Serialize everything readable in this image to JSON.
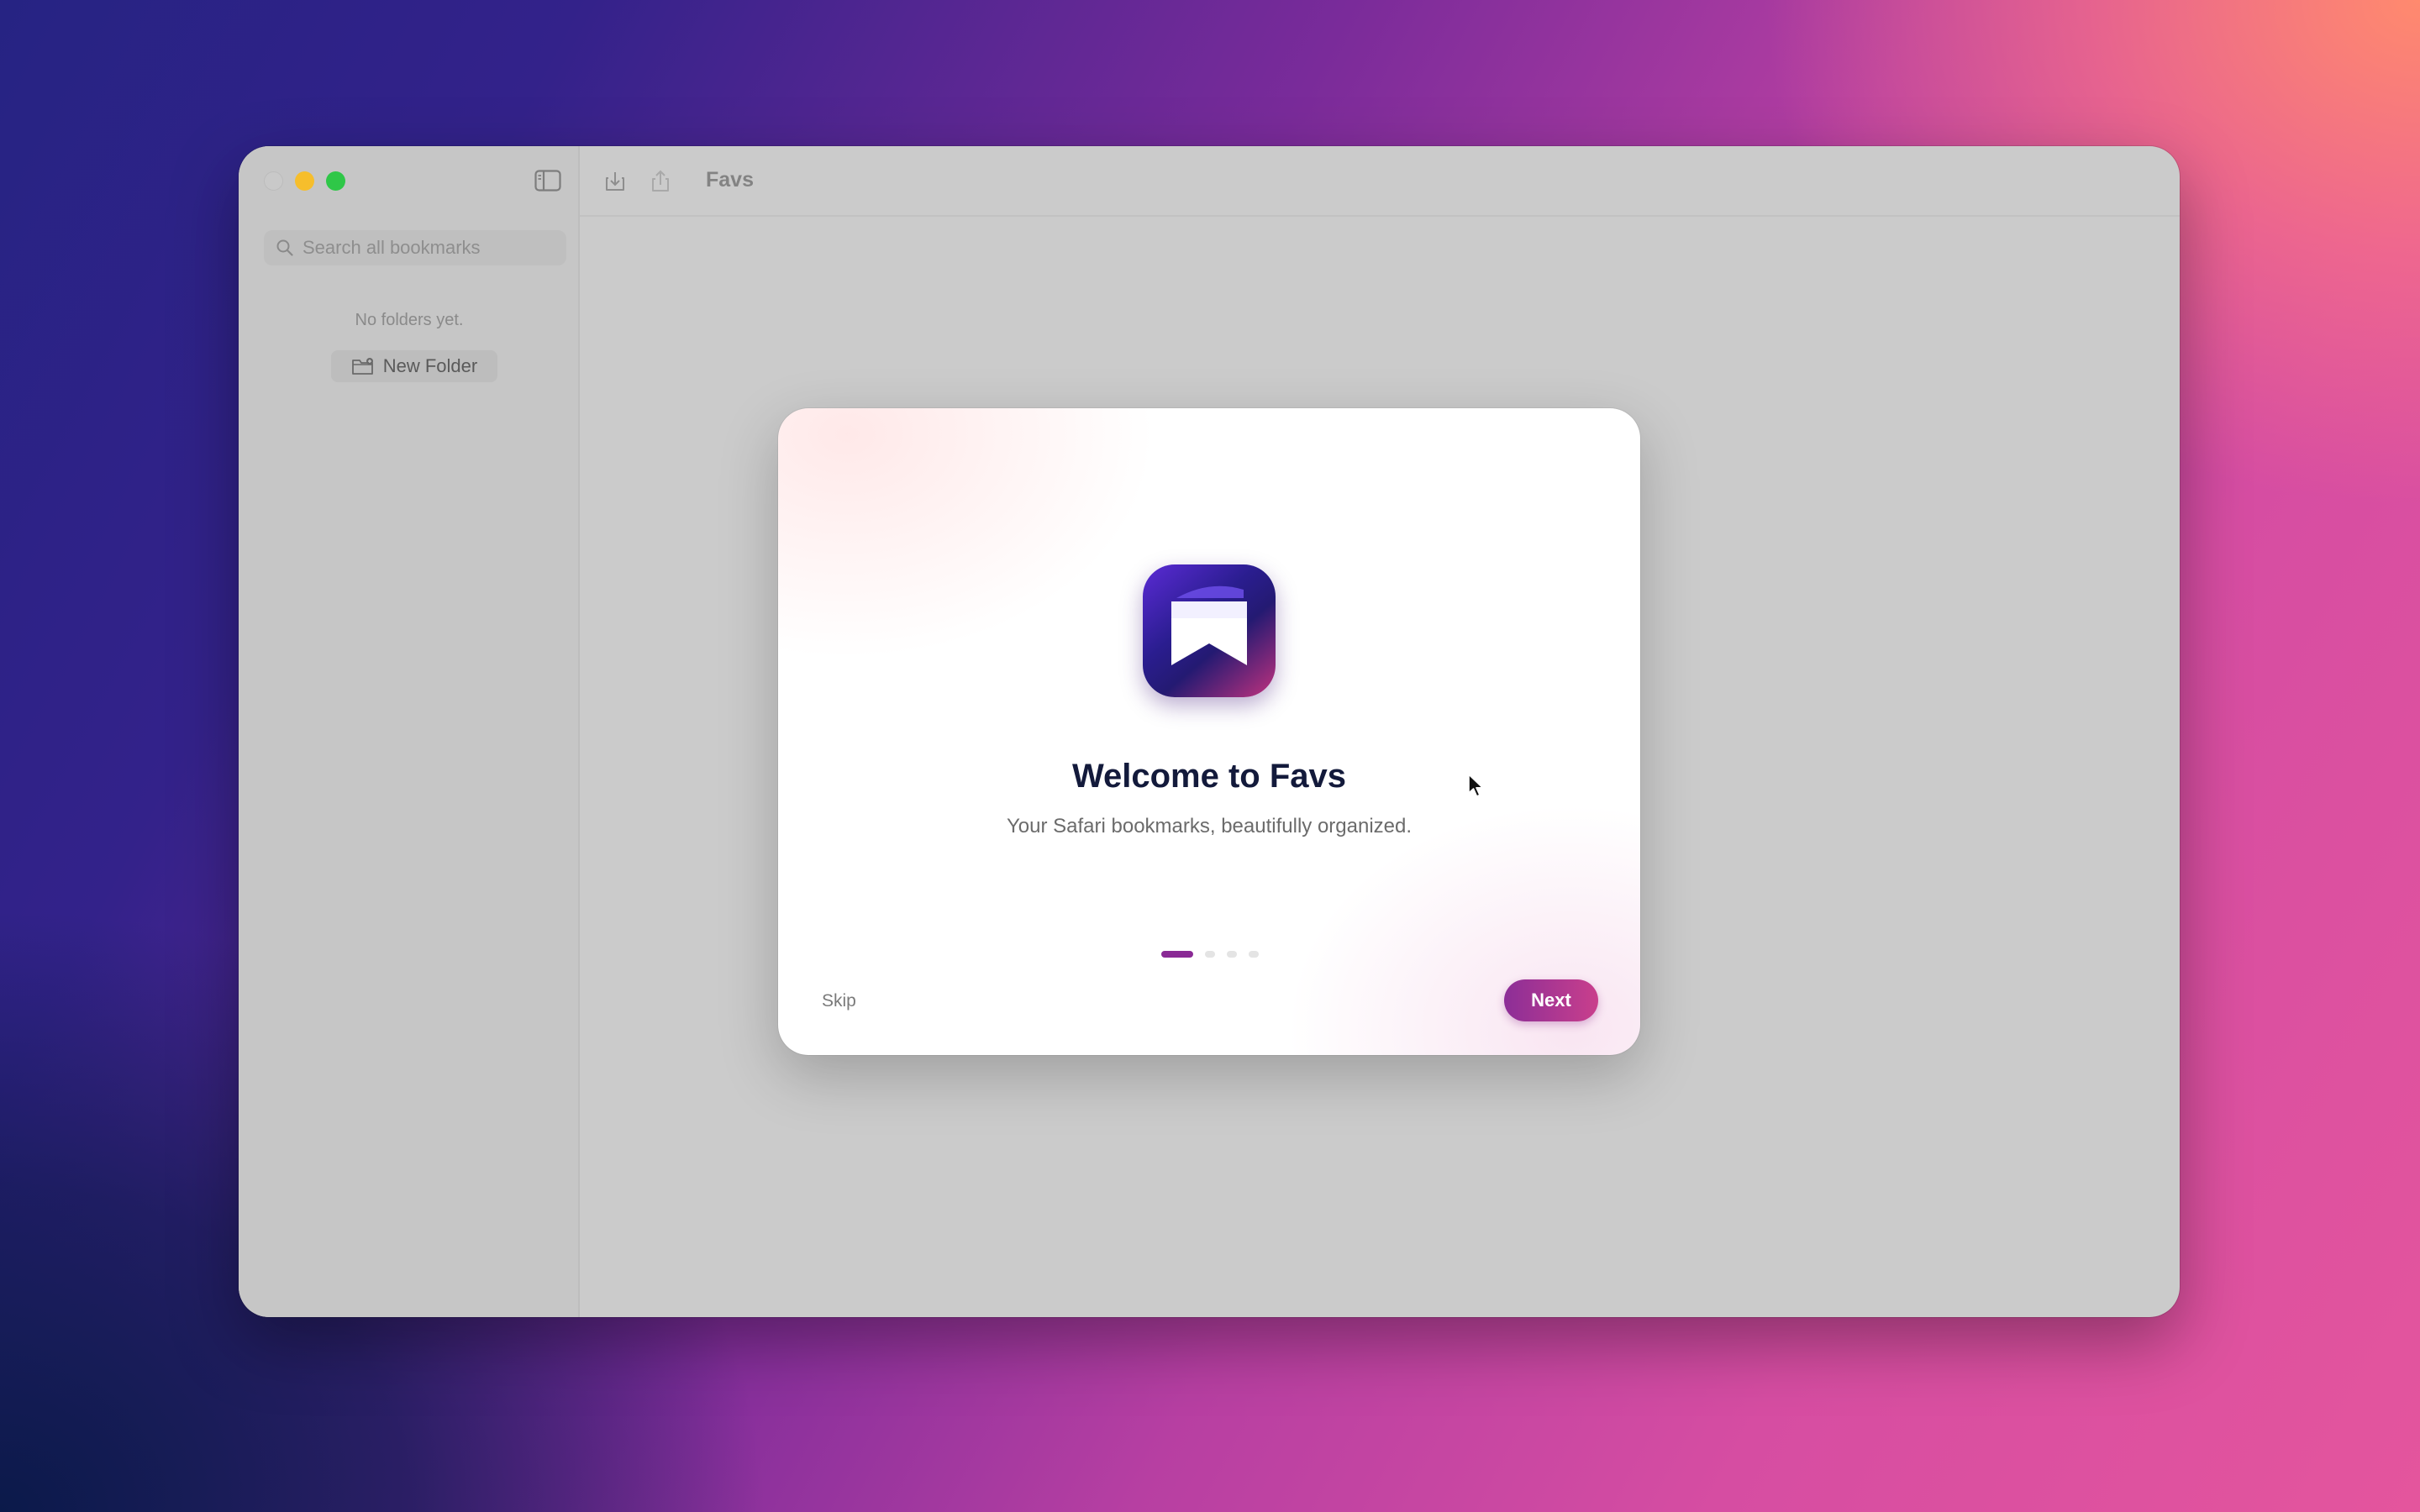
{
  "window": {
    "title": "Favs"
  },
  "sidebar": {
    "search": {
      "placeholder": "Search all bookmarks",
      "value": ""
    },
    "empty_message": "No folders yet.",
    "new_folder_label": "New Folder"
  },
  "welcome": {
    "title": "Welcome to Favs",
    "subtitle": "Your Safari bookmarks, beautifully organized.",
    "page_indicator": {
      "current": 1,
      "total": 4
    },
    "skip_label": "Skip",
    "next_label": "Next"
  },
  "colors": {
    "accent_start": "#8c2e97",
    "accent_end": "#c93f8c",
    "title_text": "#131a3b"
  },
  "icons": [
    "sidebar-toggle-icon",
    "search-icon",
    "new-folder-icon",
    "import-icon",
    "share-icon",
    "app-bookmark-icon",
    "cursor-icon"
  ]
}
